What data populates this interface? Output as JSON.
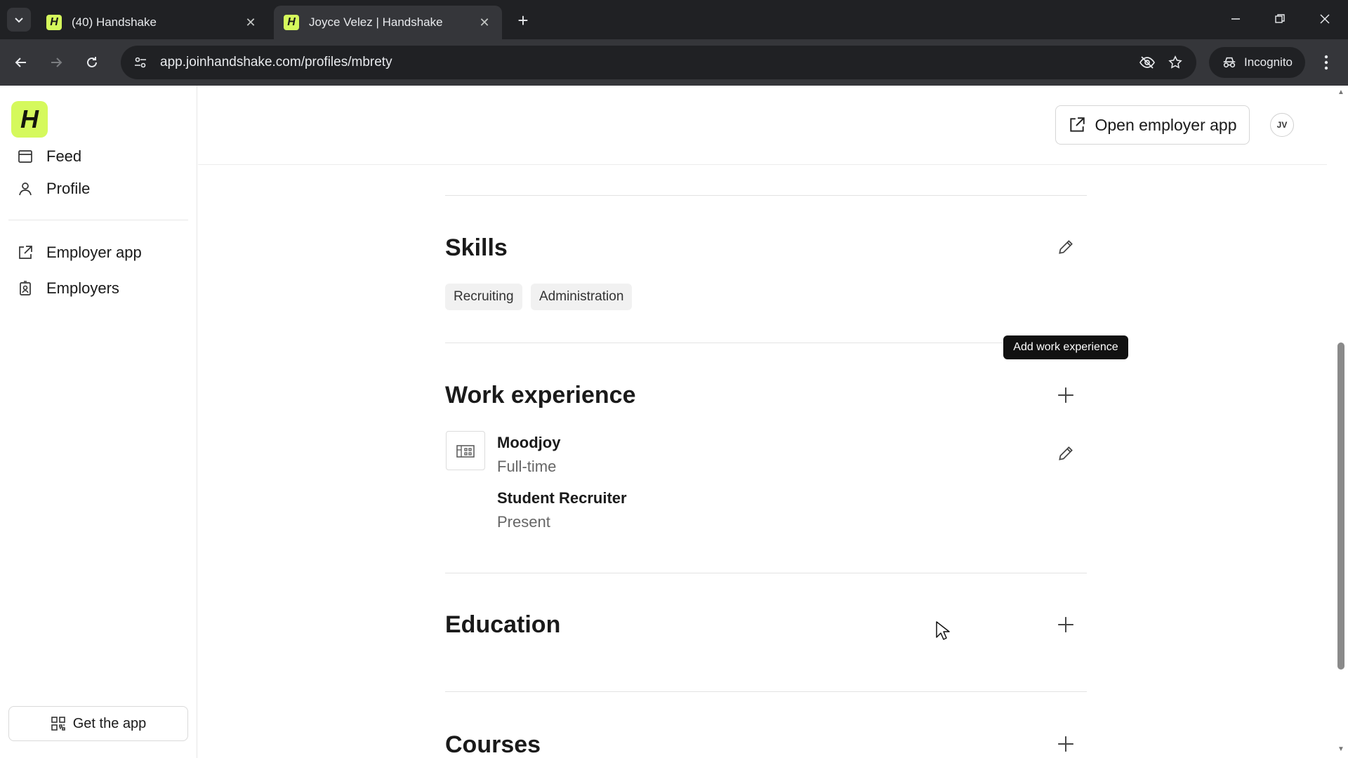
{
  "browser": {
    "tabs": [
      {
        "title": "(40) Handshake",
        "favicon": "H",
        "active": false
      },
      {
        "title": "Joyce Velez | Handshake",
        "favicon": "H",
        "active": true
      }
    ],
    "url": "app.joinhandshake.com/profiles/mbrety",
    "incognito_label": "Incognito"
  },
  "sidebar": {
    "logo": "H",
    "items": [
      {
        "label": "Feed",
        "icon": "feed-icon"
      },
      {
        "label": "Profile",
        "icon": "person-icon"
      },
      {
        "label": "Employer app",
        "icon": "external-link-icon"
      },
      {
        "label": "Employers",
        "icon": "badge-icon"
      }
    ],
    "get_app_label": "Get the app"
  },
  "header": {
    "open_employer_label": "Open employer app",
    "avatar_initials": "JV"
  },
  "skills": {
    "title": "Skills",
    "chips": [
      "Recruiting",
      "Administration"
    ]
  },
  "tooltip": "Add work experience",
  "work_experience": {
    "title": "Work experience",
    "entries": [
      {
        "company": "Moodjoy",
        "type": "Full-time",
        "role": "Student Recruiter",
        "period": "Present"
      }
    ]
  },
  "education": {
    "title": "Education"
  },
  "courses": {
    "title": "Courses"
  },
  "colors": {
    "brand": "#d5f95c",
    "chrome_dark": "#202124",
    "chrome_mid": "#35363a"
  }
}
